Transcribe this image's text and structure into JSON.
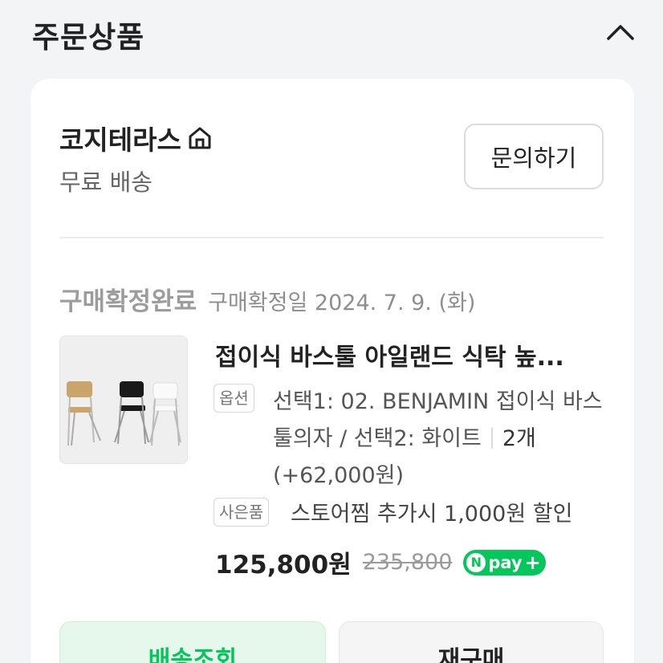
{
  "section": {
    "title": "주문상품"
  },
  "store": {
    "name": "코지테라스",
    "shipping": "무료 배송",
    "inquiry_label": "문의하기"
  },
  "order": {
    "status": "구매확정완료",
    "confirm_date": "구매확정일 2024. 7. 9. (화)"
  },
  "product": {
    "title": "접이식 바스툴 아일랜드 식탁 높...",
    "option_label": "옵션",
    "option_text": "선택1: 02. BENJAMIN 접이식 바스툴의자 / 선택2: 화이트",
    "quantity": "2개",
    "option_price": "(+62,000원)",
    "gift_label": "사은품",
    "gift_text": "스토어찜 추가시 1,000원 할인",
    "price": "125,800원",
    "original_price": "235,800",
    "pay_badge": "pay"
  },
  "actions": {
    "track_label": "배송조회",
    "rebuy_label": "재구매"
  },
  "colors": {
    "brand_green": "#03c75a",
    "track_bg": "#e6f7ec"
  },
  "icons": {
    "collapse": "chevron-up-icon",
    "store": "home-icon",
    "npay": "npay-plus-icon"
  }
}
